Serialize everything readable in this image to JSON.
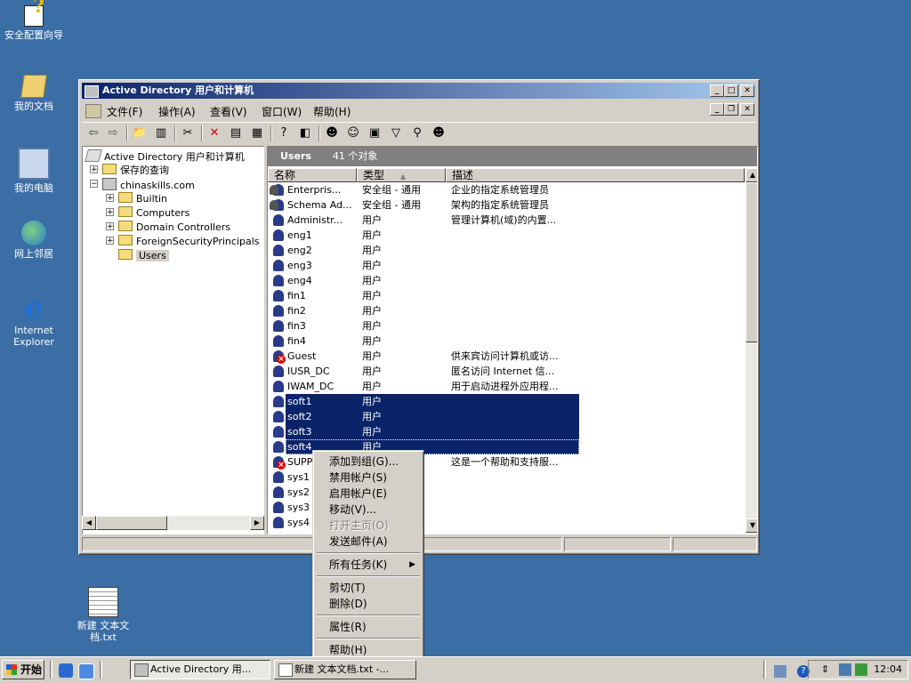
{
  "desktop": {
    "icons": [
      {
        "label": "安全配置向导",
        "icon": "security-wizard-icon"
      },
      {
        "label": "我的文档",
        "icon": "my-documents-icon"
      },
      {
        "label": "我的电脑",
        "icon": "my-computer-icon"
      },
      {
        "label": "网上邻居",
        "icon": "network-places-icon"
      },
      {
        "label": "Internet Explorer",
        "icon": "internet-explorer-icon"
      },
      {
        "label": "新建 文本文档.txt",
        "icon": "text-file-icon"
      }
    ]
  },
  "window": {
    "title": "Active Directory 用户和计算机",
    "menu": [
      "文件(F)",
      "操作(A)",
      "查看(V)",
      "窗口(W)",
      "帮助(H)"
    ],
    "tree": {
      "root": "Active Directory 用户和计算机",
      "saved_queries": "保存的查询",
      "domain": "chinaskills.com",
      "children": [
        "Builtin",
        "Computers",
        "Domain Controllers",
        "ForeignSecurityPrincipals",
        "Users"
      ]
    },
    "list": {
      "container": "Users",
      "count": "41 个对象",
      "columns": [
        "名称",
        "类型",
        "描述"
      ],
      "sort_indicator": "▲",
      "rows": [
        {
          "name": "Enterpris...",
          "type": "安全组 - 通用",
          "desc": "企业的指定系统管理员",
          "icon": "group"
        },
        {
          "name": "Schema Ad...",
          "type": "安全组 - 通用",
          "desc": "架构的指定系统管理员",
          "icon": "group"
        },
        {
          "name": "Administr...",
          "type": "用户",
          "desc": "管理计算机(域)的内置...",
          "icon": "user"
        },
        {
          "name": "eng1",
          "type": "用户",
          "desc": "",
          "icon": "user"
        },
        {
          "name": "eng2",
          "type": "用户",
          "desc": "",
          "icon": "user"
        },
        {
          "name": "eng3",
          "type": "用户",
          "desc": "",
          "icon": "user"
        },
        {
          "name": "eng4",
          "type": "用户",
          "desc": "",
          "icon": "user"
        },
        {
          "name": "fin1",
          "type": "用户",
          "desc": "",
          "icon": "user"
        },
        {
          "name": "fin2",
          "type": "用户",
          "desc": "",
          "icon": "user"
        },
        {
          "name": "fin3",
          "type": "用户",
          "desc": "",
          "icon": "user"
        },
        {
          "name": "fin4",
          "type": "用户",
          "desc": "",
          "icon": "user"
        },
        {
          "name": "Guest",
          "type": "用户",
          "desc": "供来宾访问计算机或访...",
          "icon": "disabled-user"
        },
        {
          "name": "IUSR_DC",
          "type": "用户",
          "desc": "匿名访问 Internet 信...",
          "icon": "user"
        },
        {
          "name": "IWAM_DC",
          "type": "用户",
          "desc": "用于启动进程外应用程...",
          "icon": "user"
        },
        {
          "name": "soft1",
          "type": "用户",
          "desc": "",
          "icon": "user",
          "selected": true
        },
        {
          "name": "soft2",
          "type": "用户",
          "desc": "",
          "icon": "user",
          "selected": true
        },
        {
          "name": "soft3",
          "type": "用户",
          "desc": "",
          "icon": "user",
          "selected": true
        },
        {
          "name": "soft4",
          "type": "用户",
          "desc": "",
          "icon": "user",
          "selected": true,
          "focused": true
        },
        {
          "name": "SUPPO",
          "type": "",
          "desc": "这是一个帮助和支持服...",
          "icon": "disabled-user"
        },
        {
          "name": "sys1",
          "type": "",
          "desc": "",
          "icon": "user"
        },
        {
          "name": "sys2",
          "type": "",
          "desc": "",
          "icon": "user"
        },
        {
          "name": "sys3",
          "type": "",
          "desc": "",
          "icon": "user"
        },
        {
          "name": "sys4",
          "type": "",
          "desc": "",
          "icon": "user"
        }
      ]
    }
  },
  "context_menu": {
    "items": [
      {
        "label": "添加到组(G)...",
        "enabled": true
      },
      {
        "label": "禁用帐户(S)",
        "enabled": true
      },
      {
        "label": "启用帐户(E)",
        "enabled": true
      },
      {
        "label": "移动(V)...",
        "enabled": true
      },
      {
        "label": "打开主页(O)",
        "enabled": false
      },
      {
        "label": "发送邮件(A)",
        "enabled": true
      },
      {
        "separator": true
      },
      {
        "label": "所有任务(K)",
        "enabled": true,
        "submenu": true
      },
      {
        "separator": true
      },
      {
        "label": "剪切(T)",
        "enabled": true
      },
      {
        "label": "删除(D)",
        "enabled": true
      },
      {
        "separator": true
      },
      {
        "label": "属性(R)",
        "enabled": true
      },
      {
        "separator": true
      },
      {
        "label": "帮助(H)",
        "enabled": true
      }
    ]
  },
  "taskbar": {
    "start": "开始",
    "tasks": [
      {
        "label": "Active Directory 用...",
        "active": true
      },
      {
        "label": "新建 文本文档.txt -...",
        "active": false
      }
    ],
    "clock": "12:04"
  },
  "colors": {
    "desktop": "#3a6ea5",
    "selection": "#0a246a",
    "titlebar": "#0a246a"
  }
}
